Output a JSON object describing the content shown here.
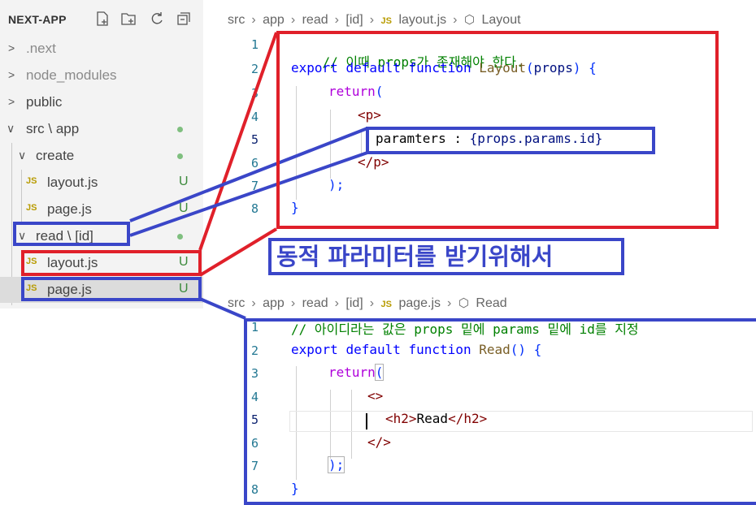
{
  "explorer": {
    "title": "NEXT-APP",
    "tools": [
      "new-file-icon",
      "new-folder-icon",
      "refresh-icon",
      "collapse-all-icon"
    ],
    "items": [
      {
        "label": ".next",
        "chevron": ">",
        "status": ""
      },
      {
        "label": "node_modules",
        "chevron": ">",
        "status": ""
      },
      {
        "label": "public",
        "chevron": ">",
        "status": ""
      },
      {
        "label": "src \\ app",
        "chevron": "∨",
        "status": "dot"
      },
      {
        "label": "create",
        "chevron": "∨",
        "status": "dot"
      },
      {
        "label": "layout.js",
        "badge": "JS",
        "status": "U"
      },
      {
        "label": "page.js",
        "badge": "JS",
        "status": "U"
      },
      {
        "label": "read \\ [id]",
        "chevron": "∨",
        "status": "dot"
      },
      {
        "label": "layout.js",
        "badge": "JS",
        "status": "U"
      },
      {
        "label": "page.js",
        "badge": "JS",
        "status": "U"
      }
    ]
  },
  "top_editor": {
    "breadcrumb": [
      "src",
      "app",
      "read",
      "[id]",
      "layout.js",
      "Layout"
    ],
    "breadcrumb_badge": "JS",
    "line_numbers": [
      "1",
      "2",
      "3",
      "4",
      "5",
      "6",
      "7",
      "8"
    ],
    "lines": {
      "l1_comment": "// 이때 props가 존재해야 한다.",
      "l2_export": "export",
      "l2_default": "default",
      "l2_function": "function",
      "l2_name": "Layout",
      "l2_paren_open": "(",
      "l2_param": "props",
      "l2_rest": ") {",
      "l3_return": "return",
      "l3_paren": "(",
      "l4_tag": "<p>",
      "l5_text": "paramters : ",
      "l5_expr": "{props.params.id}",
      "l6_tag": "</p>",
      "l7": ");",
      "l8": "}"
    }
  },
  "bottom_editor": {
    "breadcrumb": [
      "src",
      "app",
      "read",
      "[id]",
      "page.js",
      "Read"
    ],
    "breadcrumb_badge": "JS",
    "line_numbers": [
      "1",
      "2",
      "3",
      "4",
      "5",
      "6",
      "7",
      "8"
    ],
    "lines": {
      "l1_comment": "// 아이디라는 값은 props 밑에 params 밑에 id를 지정",
      "l2_export": "export",
      "l2_default": "default",
      "l2_function": "function",
      "l2_name": "Read",
      "l2_rest": "() {",
      "l3_return": "return",
      "l3_paren": "(",
      "l4": "<>",
      "l5_open": "<h2>",
      "l5_text": "Read",
      "l5_close": "</h2>",
      "l6": "</>",
      "l7": ");",
      "l8": "}"
    }
  },
  "caption": "동적 파라미터를 받기위해서",
  "colors": {
    "red_annotation": "#e0202a",
    "blue_annotation": "#3a46c8"
  }
}
